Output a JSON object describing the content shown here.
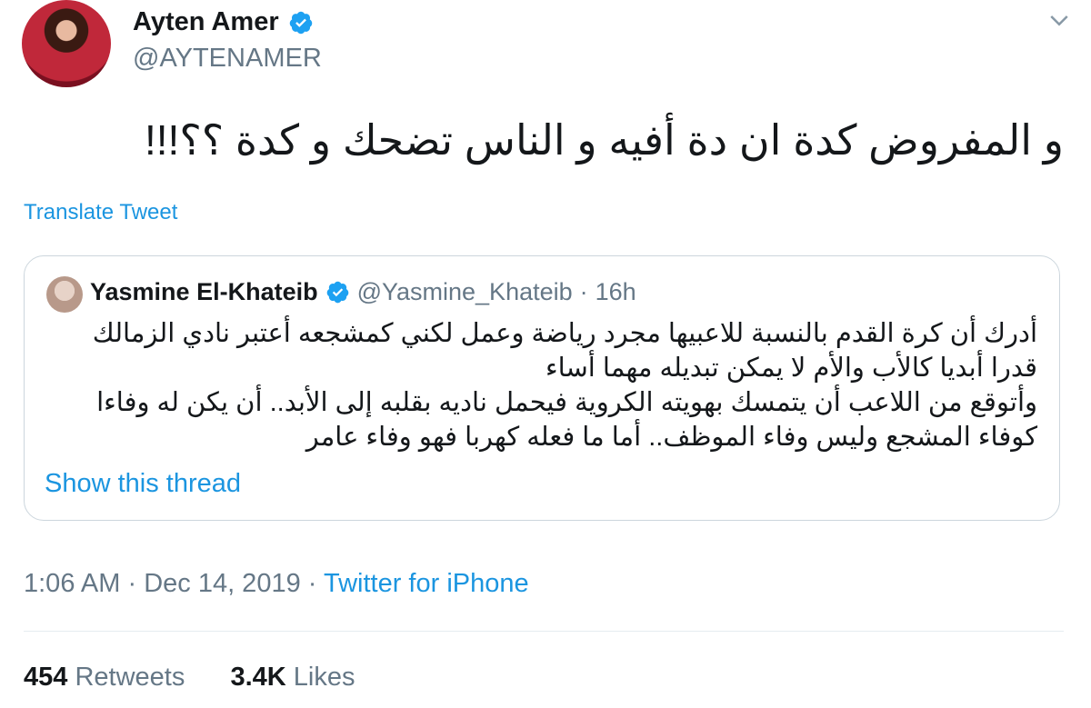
{
  "tweet": {
    "author_name": "Ayten Amer",
    "author_handle": "@AYTENAMER",
    "text": "و المفروض كدة ان دة أفيه و الناس تضحك و كدة ؟؟!!!",
    "translate_label": "Translate Tweet",
    "time": "1:06 AM",
    "date": "Dec 14, 2019",
    "source": "Twitter for iPhone",
    "retweets_count": "454",
    "retweets_label": "Retweets",
    "likes_count": "3.4K",
    "likes_label": "Likes"
  },
  "quoted": {
    "author_name": "Yasmine El-Khateib",
    "author_handle": "@Yasmine_Khateib",
    "age": "16h",
    "lines": [
      "أدرك أن كرة القدم بالنسبة للاعبيها مجرد رياضة وعمل لكني كمشجعه أعتبر نادي الزمالك",
      "قدرا أبديا كالأب والأم لا يمكن تبديله مهما أساء",
      "وأتوقع من اللاعب أن يتمسك بهويته الكروية فيحمل ناديه بقلبه إلى الأبد.. أن يكن له وفاءا",
      "كوفاء المشجع وليس وفاء الموظف.. أما ما فعله كهربا فهو وفاء عامر"
    ],
    "show_thread_label": "Show this thread"
  },
  "icons": {
    "verified": "verified-badge-icon",
    "caret": "chevron-down-icon"
  },
  "colors": {
    "link": "#1b95e0",
    "verified": "#1da1f2",
    "muted": "#657786"
  }
}
